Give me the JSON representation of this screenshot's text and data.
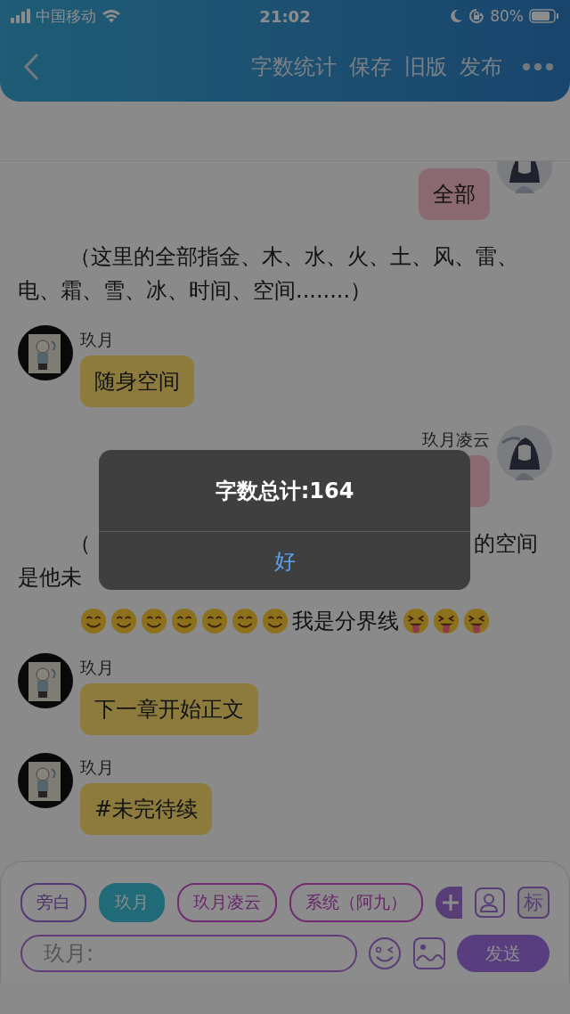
{
  "status_bar": {
    "carrier": "中国移动",
    "time": "21:02",
    "battery": "80%"
  },
  "header": {
    "actions": [
      "字数统计",
      "保存",
      "旧版",
      "发布"
    ]
  },
  "messages": [
    {
      "kind": "outgoing",
      "text": "全部"
    },
    {
      "kind": "narration",
      "text": "（这里的全部指金、木、水、火、土、风、雷、电、霜、雪、冰、时间、空间........）"
    },
    {
      "kind": "incoming",
      "name": "玖月",
      "text": "随身空间"
    },
    {
      "kind": "outgoing",
      "name": "玖月凌云"
    },
    {
      "kind": "covered_narration",
      "fragments": [
        "（",
        "的空间",
        "是他未"
      ]
    },
    {
      "kind": "divider",
      "text": "我是分界线"
    },
    {
      "kind": "incoming",
      "name": "玖月",
      "text": "下一章开始正文"
    },
    {
      "kind": "incoming",
      "name": "玖月",
      "text": "#未完待续"
    }
  ],
  "input_bar": {
    "roles": [
      {
        "label": "旁白",
        "selected": false
      },
      {
        "label": "玖月",
        "selected": true
      },
      {
        "label": "玖月凌云",
        "selected": false
      },
      {
        "label": "系统（阿九）",
        "selected": false
      }
    ],
    "tag_button": "标",
    "placeholder": "玖月:",
    "send": "发送"
  },
  "alert": {
    "message": "字数总计:164",
    "button": "好"
  }
}
